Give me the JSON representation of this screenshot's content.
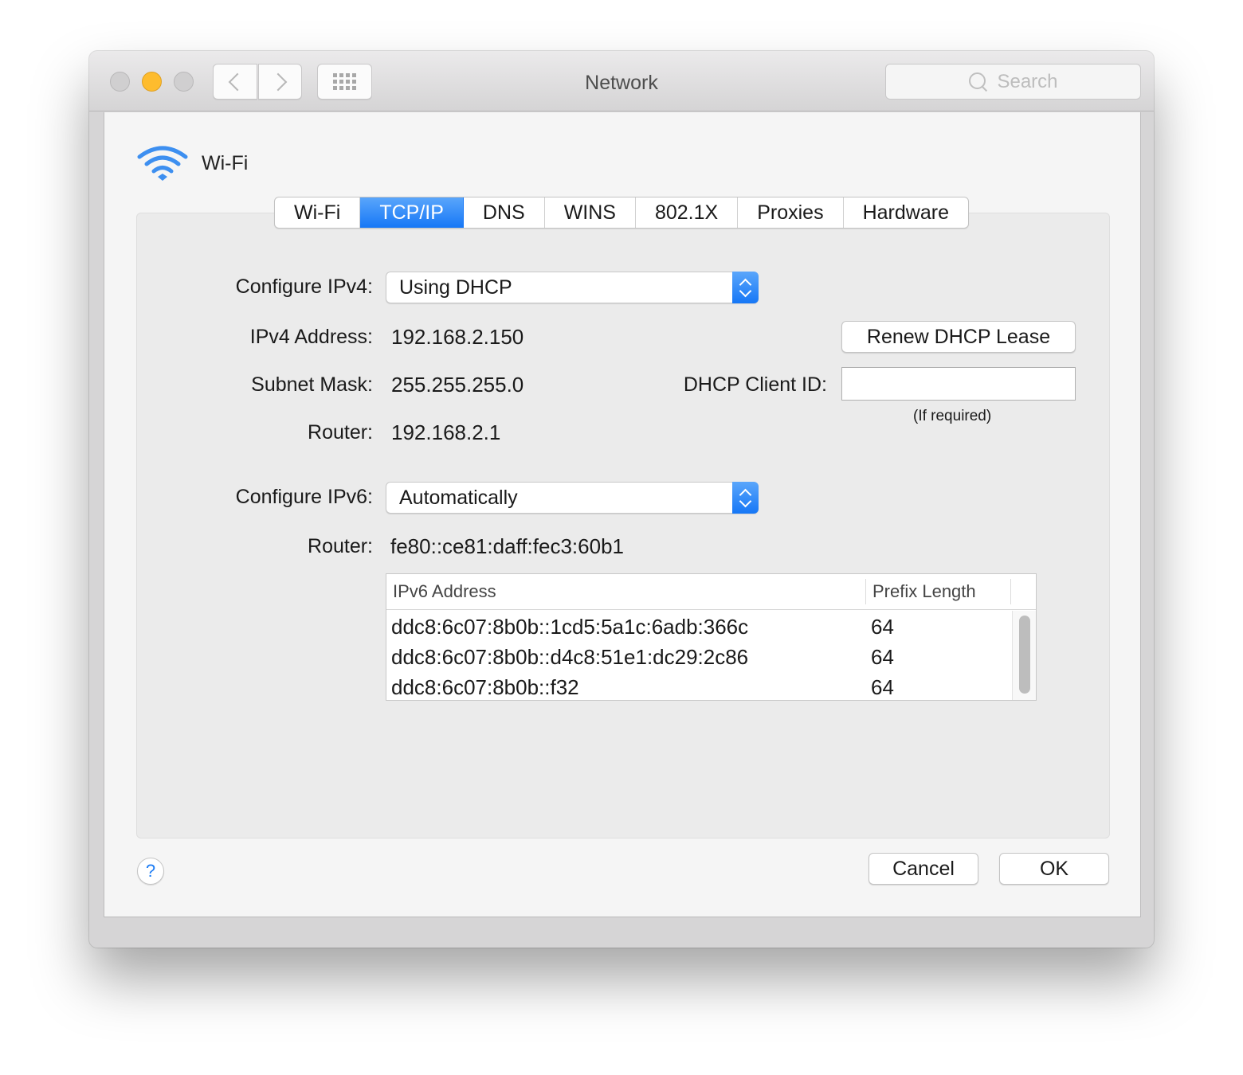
{
  "window": {
    "title": "Network",
    "search_placeholder": "Search"
  },
  "interface": {
    "name": "Wi-Fi",
    "icon": "wifi-icon"
  },
  "tabs": [
    {
      "label": "Wi-Fi",
      "active": false
    },
    {
      "label": "TCP/IP",
      "active": true
    },
    {
      "label": "DNS",
      "active": false
    },
    {
      "label": "WINS",
      "active": false
    },
    {
      "label": "802.1X",
      "active": false
    },
    {
      "label": "Proxies",
      "active": false
    },
    {
      "label": "Hardware",
      "active": false
    }
  ],
  "ipv4": {
    "configure_label": "Configure IPv4:",
    "configure_value": "Using DHCP",
    "address_label": "IPv4 Address:",
    "address_value": "192.168.2.150",
    "subnet_label": "Subnet Mask:",
    "subnet_value": "255.255.255.0",
    "router_label": "Router:",
    "router_value": "192.168.2.1",
    "renew_button": "Renew DHCP Lease",
    "client_id_label": "DHCP Client ID:",
    "client_id_value": "",
    "client_id_hint": "(If required)"
  },
  "ipv6": {
    "configure_label": "Configure IPv6:",
    "configure_value": "Automatically",
    "router_label": "Router:",
    "router_value": "fe80::ce81:daff:fec3:60b1",
    "table": {
      "columns": [
        "IPv6 Address",
        "Prefix Length"
      ],
      "rows": [
        {
          "address": "ddc8:6c07:8b0b::1cd5:5a1c:6adb:366c",
          "prefix": "64"
        },
        {
          "address": "ddc8:6c07:8b0b::d4c8:51e1:dc29:2c86",
          "prefix": "64"
        },
        {
          "address": "ddc8:6c07:8b0b::f32",
          "prefix": "64"
        }
      ]
    }
  },
  "footer": {
    "help_label": "?",
    "cancel_label": "Cancel",
    "ok_label": "OK"
  },
  "colors": {
    "accent": "#1677f6",
    "minimize": "#febc2e"
  }
}
